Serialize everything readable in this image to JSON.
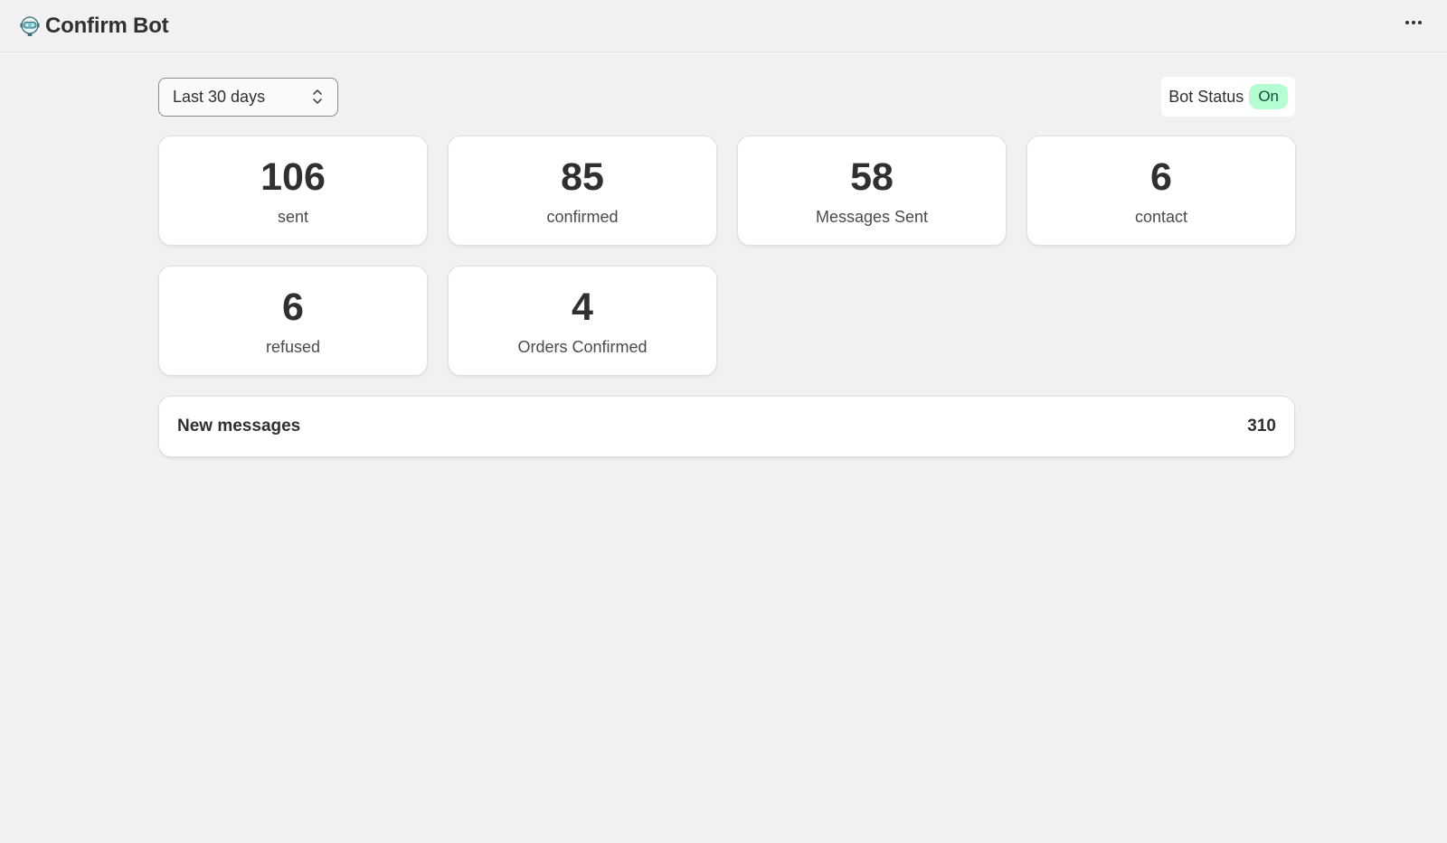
{
  "app": {
    "title": "Confirm Bot",
    "logo_icon": "robot-icon",
    "menu_icon": "more-horizontal-icon"
  },
  "controls": {
    "date_range": {
      "selected": "Last 30 days"
    },
    "bot_status": {
      "label": "Bot Status",
      "value": "On",
      "accent": "#b4fed2"
    }
  },
  "stats": [
    {
      "value": "106",
      "label": "sent"
    },
    {
      "value": "85",
      "label": "confirmed"
    },
    {
      "value": "58",
      "label": "Messages Sent"
    },
    {
      "value": "6",
      "label": "contact"
    },
    {
      "value": "6",
      "label": "refused"
    },
    {
      "value": "4",
      "label": "Orders Confirmed"
    }
  ],
  "new_messages": {
    "label": "New messages",
    "count": "310"
  }
}
